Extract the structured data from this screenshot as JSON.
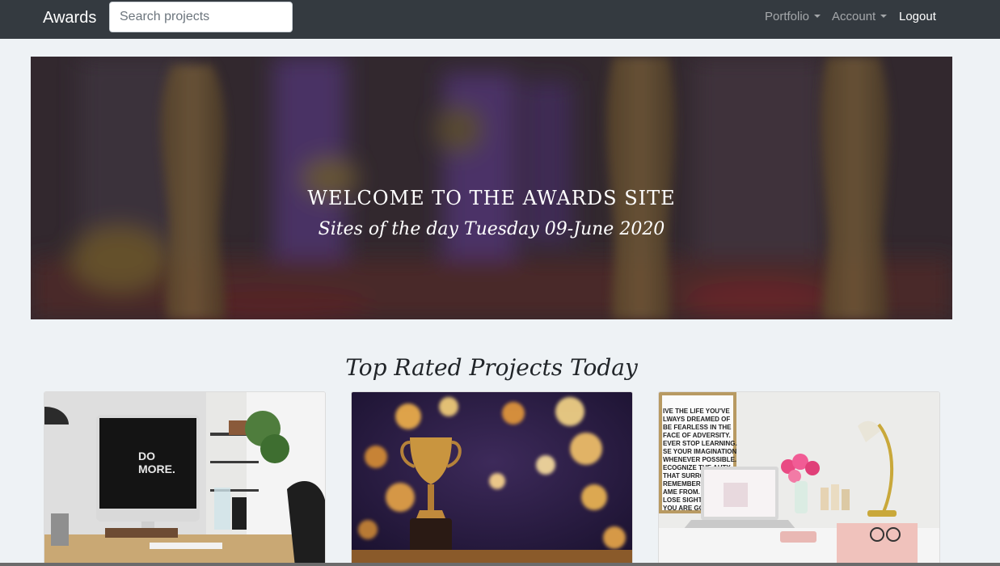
{
  "navbar": {
    "brand": "Awards",
    "search_placeholder": "Search projects",
    "links": {
      "portfolio": "Portfolio",
      "account": "Account",
      "logout": "Logout"
    },
    "background": "#343a40"
  },
  "hero": {
    "title": "WELCOME TO THE AWARDS SITE",
    "subtitle": "Sites of the day Tuesday 09-June 2020"
  },
  "section": {
    "title": "Top Rated Projects Today"
  },
  "cards": [
    {
      "image": "desk-computer-do-more-image",
      "screen_text_1": "DO",
      "screen_text_2": "MORE."
    },
    {
      "image": "trophy-bokeh-image"
    },
    {
      "image": "white-desk-laptop-flowers-image",
      "poster_lines": [
        "IVE THE LIFE YOU'VE",
        "LWAYS DREAMED OF",
        "BE FEARLESS IN THE",
        "FACE OF ADVERSITY.",
        "EVER STOP LEARNING.",
        "SE YOUR IMAGINATION",
        "WHENEVER POSSIBLE.",
        "ECOGNIZE THE AUTY",
        "THAT SURROUND",
        "REMEMBER WH",
        "AME FROM. B",
        "LOSE SIGHT OF",
        "YOU ARE GO"
      ]
    }
  ]
}
